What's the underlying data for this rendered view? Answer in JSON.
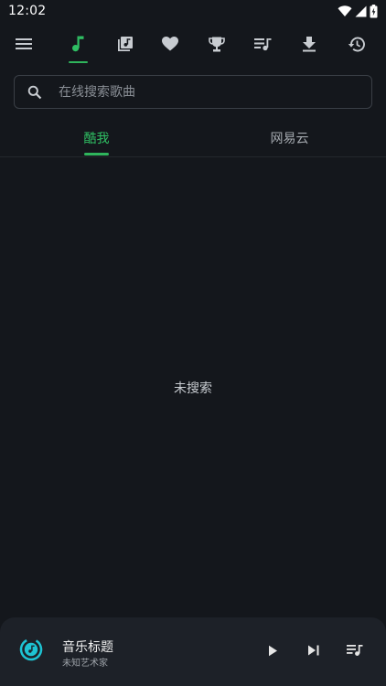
{
  "status_bar": {
    "time": "12:02",
    "icons": [
      "wifi-icon",
      "cell-signal-icon",
      "battery-icon"
    ]
  },
  "top_nav": {
    "items": [
      {
        "icon": "menu-icon",
        "active": false
      },
      {
        "icon": "music-note-icon",
        "active": true
      },
      {
        "icon": "music-library-icon",
        "active": false
      },
      {
        "icon": "heart-icon",
        "active": false
      },
      {
        "icon": "trophy-icon",
        "active": false
      },
      {
        "icon": "playlist-icon",
        "active": false
      },
      {
        "icon": "download-icon",
        "active": false
      },
      {
        "icon": "history-icon",
        "active": false
      }
    ]
  },
  "search": {
    "placeholder": "在线搜索歌曲",
    "value": ""
  },
  "tabs": {
    "items": [
      {
        "label": "酷我",
        "active": true
      },
      {
        "label": "网易云",
        "active": false
      }
    ]
  },
  "main": {
    "empty_text": "未搜索"
  },
  "player": {
    "title": "音乐标题",
    "artist": "未知艺术家",
    "controls": [
      "play-icon",
      "skip-next-icon",
      "queue-music-icon"
    ]
  },
  "colors": {
    "background": "#14171c",
    "accent": "#2fb55c",
    "player_background": "#1d2128",
    "icon": "#c8ccd1"
  }
}
